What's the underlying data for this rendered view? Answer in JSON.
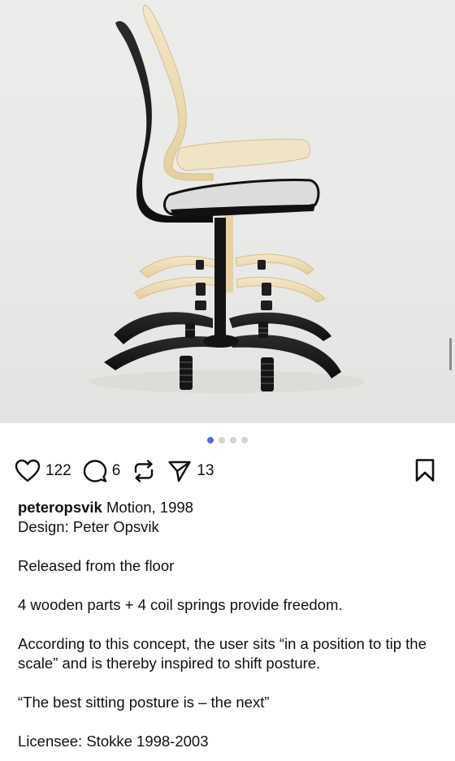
{
  "post": {
    "image": {
      "description_icon": "chair-photo",
      "carousel": {
        "total": 4,
        "active_index": 0,
        "active_color": "#4a6cf0",
        "inactive_color": "#d4d4d4"
      }
    },
    "actions": {
      "like": {
        "icon": "heart-icon",
        "count": "122"
      },
      "comment": {
        "icon": "comment-icon",
        "count": "6"
      },
      "repost": {
        "icon": "repost-icon"
      },
      "share": {
        "icon": "send-icon",
        "count": "13"
      },
      "bookmark": {
        "icon": "bookmark-icon"
      }
    },
    "caption": {
      "username": "peteropsvik",
      "title": " Motion, 1998",
      "line2": "Design: Peter Opsvik",
      "para1": "Released from the floor",
      "para2": "4 wooden parts + 4 coil springs provide freedom.",
      "para3": "According to this concept, the user sits “in a position to tip the scale” and is thereby inspired to shift posture.",
      "para4": "“The best sitting posture is – the next”",
      "para5": "Licensee: Stokke 1998-2003"
    }
  }
}
